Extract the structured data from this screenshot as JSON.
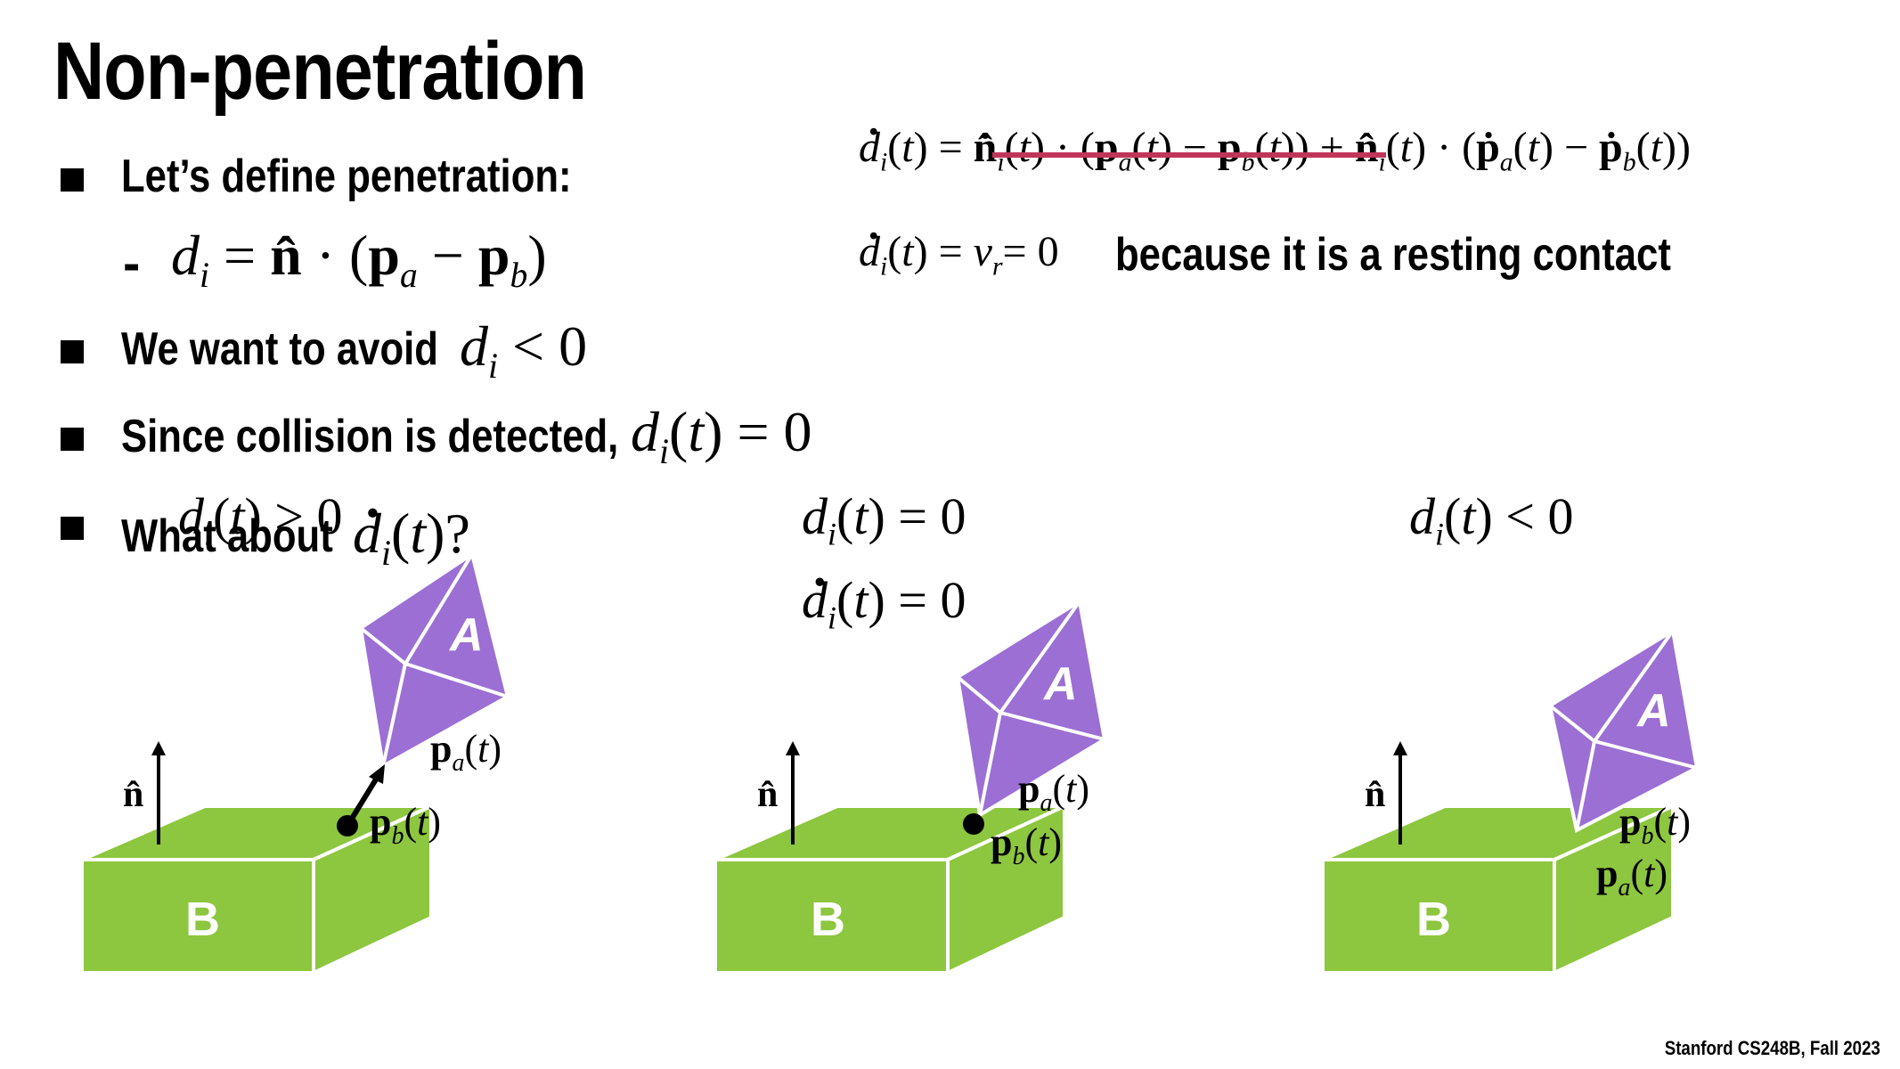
{
  "title": "Non-penetration",
  "bullets": [
    {
      "text": "Let’s define penetration:"
    },
    {
      "text": "We want to avoid"
    },
    {
      "text": "Since collision is detected,"
    },
    {
      "text": "What about"
    }
  ],
  "sub_bullet_dash": "-",
  "equations": {
    "top_because": "because it is a resting contact"
  },
  "cases": [
    {
      "label": "d_i(t) > 0",
      "box_label": "B",
      "body_label": "A"
    },
    {
      "label": "d_i(t) = 0",
      "box_label": "B",
      "body_label": "A"
    },
    {
      "label": "d_i(t) < 0",
      "box_label": "B",
      "body_label": "A"
    }
  ],
  "footer": "Stanford CS248B, Fall 2023",
  "colors": {
    "box_green": "#8dc63f",
    "body_purple": "#9b6fd4",
    "strike_red": "#c0355a"
  }
}
